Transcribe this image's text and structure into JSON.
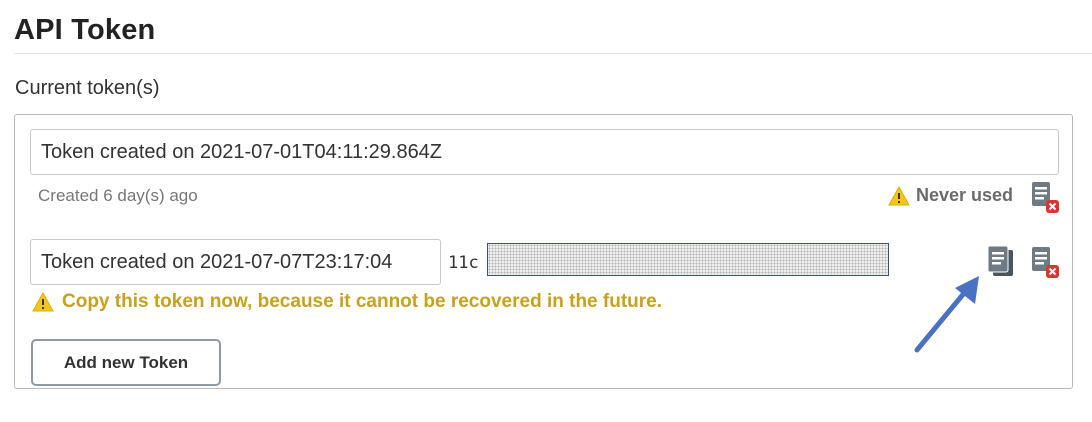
{
  "page": {
    "title": "API Token",
    "section_label": "Current token(s)"
  },
  "tokens": [
    {
      "name": "Token created on 2021-07-01T04:11:29.864Z",
      "created": "Created 6 day(s) ago",
      "usage": "Never used",
      "icons": [
        "warning-icon",
        "revoke-token-icon"
      ]
    },
    {
      "name": "Token created on 2021-07-07T23:17:04",
      "value_prefix": "11c",
      "value_masked": true,
      "icons": [
        "copy-icon",
        "revoke-token-icon"
      ]
    }
  ],
  "copy_warning": "Copy this token now, because it cannot be recovered in the future.",
  "add_button_label": "Add new Token",
  "colors": {
    "warning_text": "#c9a21a",
    "warning_triangle": "#f5c518",
    "delete_badge": "#d9372b",
    "annotation_arrow": "#4a72c4"
  }
}
